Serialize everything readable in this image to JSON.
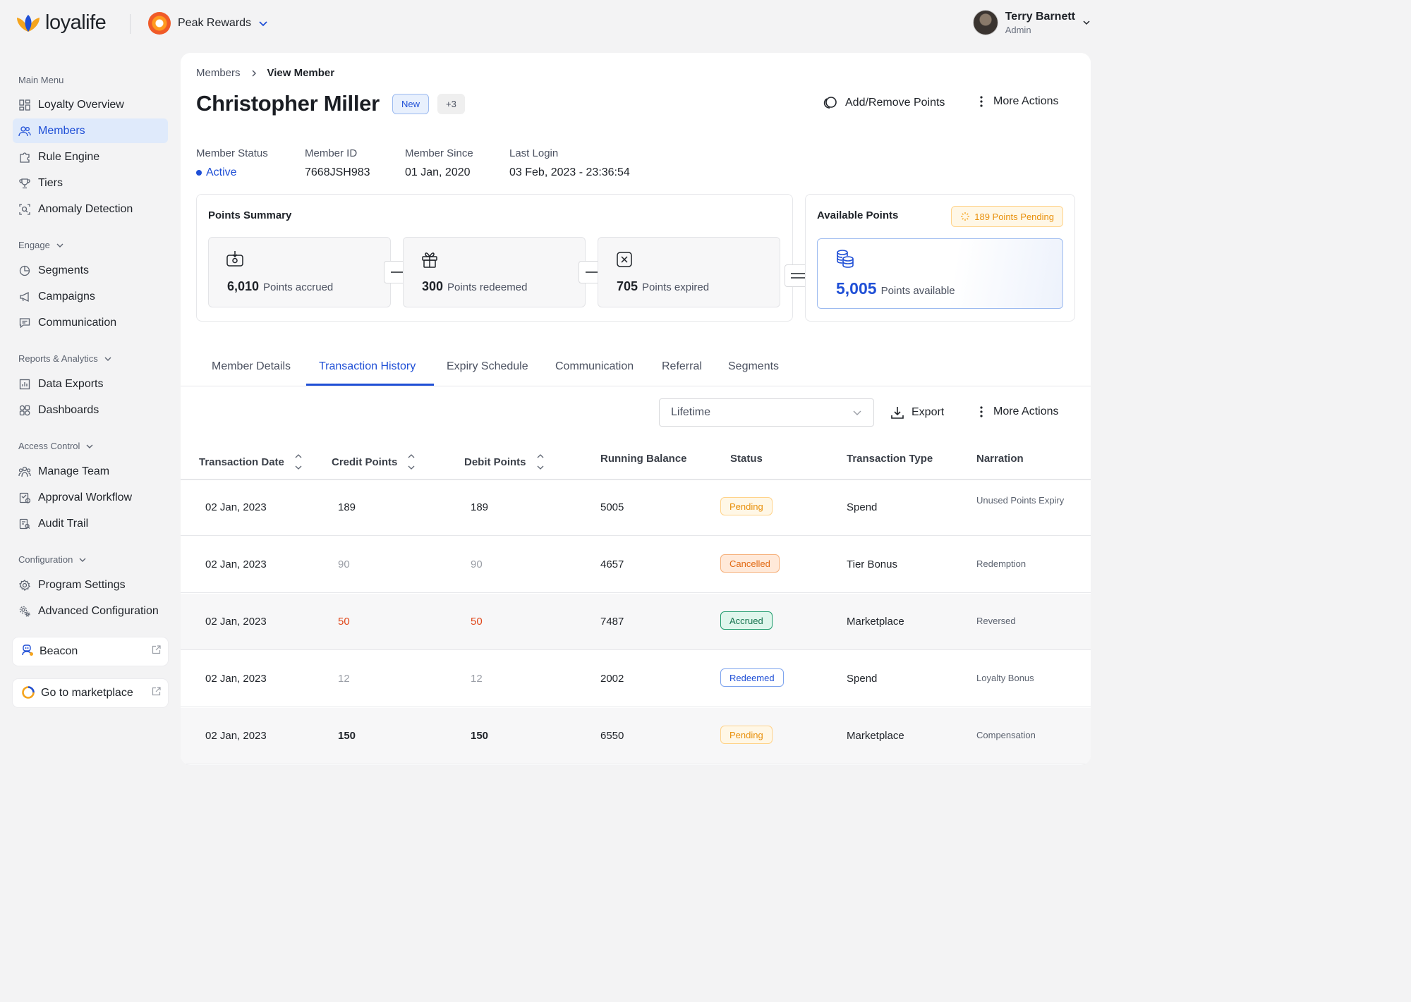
{
  "header": {
    "app_name": "loyalife",
    "program_name": "Peak Rewards",
    "user_name": "Terry Barnett",
    "user_role": "Admin"
  },
  "sidebar": {
    "main_menu_title": "Main Menu",
    "main_menu": [
      "Loyalty Overview",
      "Members",
      "Rule Engine",
      "Tiers",
      "Anomaly Detection"
    ],
    "engage_title": "Engage",
    "engage": [
      "Segments",
      "Campaigns",
      "Communication"
    ],
    "reports_title": "Reports & Analytics",
    "reports": [
      "Data Exports",
      "Dashboards"
    ],
    "access_title": "Access Control",
    "access": [
      "Manage Team",
      "Approval Workflow",
      "Audit Trail"
    ],
    "config_title": "Configuration",
    "config": [
      "Program Settings",
      "Advanced Configuration"
    ],
    "beacon": "Beacon",
    "marketplace": "Go to marketplace",
    "active_item": "Members"
  },
  "breadcrumb": {
    "parent": "Members",
    "current": "View Member"
  },
  "member": {
    "name": "Christopher Miller",
    "badge": "New",
    "more_badges": "+3",
    "status_label": "Member Status",
    "status": "Active",
    "id_label": "Member ID",
    "id": "7668JSH983",
    "since_label": "Member Since",
    "since": "01 Jan, 2020",
    "login_label": "Last Login",
    "login": "03 Feb, 2023 - 23:36:54"
  },
  "actions": {
    "add_remove": "Add/Remove Points",
    "more": "More Actions",
    "export": "Export"
  },
  "points_summary": {
    "title": "Points Summary",
    "accrued_value": "6,010",
    "accrued_label": "Points accrued",
    "redeemed_value": "300",
    "redeemed_label": "Points redeemed",
    "expired_value": "705",
    "expired_label": "Points expired"
  },
  "available": {
    "title": "Available Points",
    "pending": "189 Points Pending",
    "value": "5,005",
    "label": "Points available"
  },
  "tabs": [
    "Member Details",
    "Transaction History",
    "Expiry Schedule",
    "Communication",
    "Referral",
    "Segments"
  ],
  "active_tab": "Transaction History",
  "filter": {
    "selected": "Lifetime"
  },
  "table": {
    "headers": [
      "Transaction Date",
      "Credit Points",
      "Debit Points",
      "Running Balance",
      "Status",
      "Transaction Type",
      "Narration"
    ],
    "rows": [
      {
        "date": "02 Jan, 2023",
        "credit": "189",
        "debit": "189",
        "balance": "5005",
        "status": "Pending",
        "type": "Spend",
        "narration": "Unused Points Expiry"
      },
      {
        "date": "02 Jan, 2023",
        "credit": "90",
        "debit": "90",
        "balance": "4657",
        "status": "Cancelled",
        "type": "Tier Bonus",
        "narration": "Redemption"
      },
      {
        "date": "02 Jan, 2023",
        "credit": "50",
        "debit": "50",
        "balance": "7487",
        "status": "Accrued",
        "type": "Marketplace",
        "narration": "Reversed"
      },
      {
        "date": "02 Jan, 2023",
        "credit": "12",
        "debit": "12",
        "balance": "2002",
        "status": "Redeemed",
        "type": "Spend",
        "narration": "Loyalty Bonus"
      },
      {
        "date": "02 Jan, 2023",
        "credit": "150",
        "debit": "150",
        "balance": "6550",
        "status": "Pending",
        "type": "Marketplace",
        "narration": "Compensation"
      }
    ]
  },
  "colors": {
    "primary": "#1f4fd6",
    "active_nav_bg": "#dfeafb",
    "pending": "#e8900c",
    "cancelled": "#e26a14",
    "accrued": "#13724d",
    "negative": "#e0481b"
  }
}
